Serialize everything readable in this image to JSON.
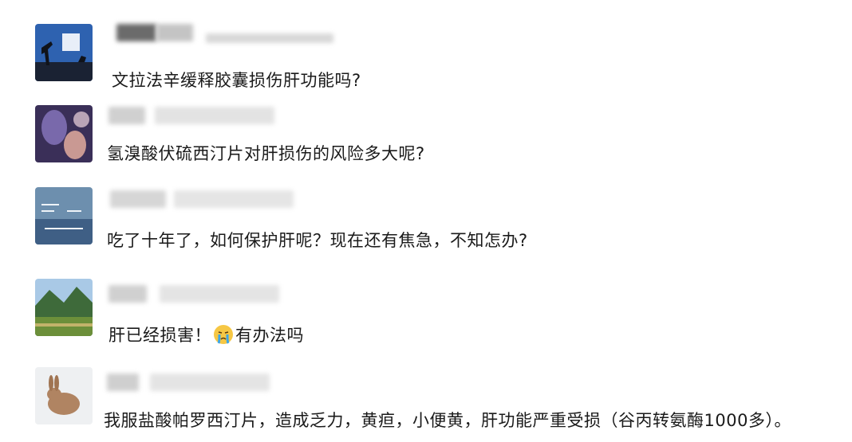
{
  "comments": [
    {
      "avatar": "silhouette-landscape-avatar",
      "text": "文拉法辛缓释胶囊损伤肝功能吗?"
    },
    {
      "avatar": "blurred-photo-avatar",
      "text": "氢溴酸伏硫西汀片对肝损伤的风险多大呢?"
    },
    {
      "avatar": "handwriting-sky-avatar",
      "text": "吃了十年了，如何保护肝呢？现在还有焦急，不知怎办?"
    },
    {
      "avatar": "green-hills-avatar",
      "text_before_emoji": "肝已经损害！",
      "emoji": "crying-face-emoji",
      "text_after_emoji": "有办法吗"
    },
    {
      "avatar": "rabbit-avatar",
      "text": "我服盐酸帕罗西汀片，造成乏力，黄疸，小便黄，肝功能严重受损（谷丙转氨酶1000多）。"
    }
  ]
}
